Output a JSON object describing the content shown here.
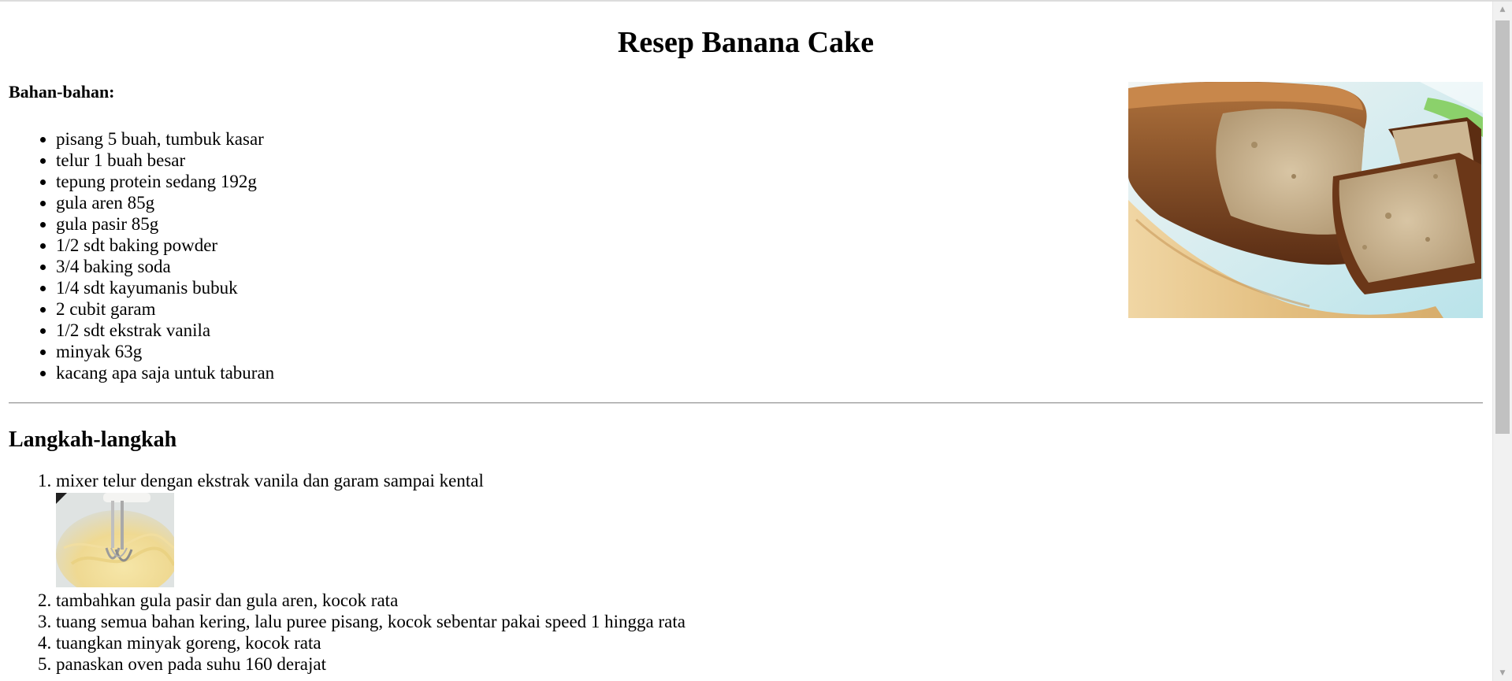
{
  "page": {
    "title": "Resep Banana Cake"
  },
  "ingredients": {
    "heading": "Bahan-bahan:",
    "items": [
      "pisang 5 buah, tumbuk kasar",
      "telur 1 buah besar",
      "tepung protein sedang 192g",
      "gula aren 85g",
      "gula pasir 85g",
      "1/2 sdt baking powder",
      "3/4 baking soda",
      "1/4 sdt kayumanis bubuk",
      "2 cubit garam",
      "1/2 sdt ekstrak vanila",
      "minyak 63g",
      "kacang apa saja untuk taburan"
    ]
  },
  "steps": {
    "heading": "Langkah-langkah",
    "items": [
      "mixer telur dengan ekstrak vanila dan garam sampai kental",
      "tambahkan gula pasir dan gula aren, kocok rata",
      "tuang semua bahan kering, lalu puree pisang, kocok sebentar pakai speed 1 hingga rata",
      "tuangkan minyak goreng, kocok rata",
      "panaskan oven pada suhu 160 derajat"
    ]
  },
  "icons": {
    "scroll_up": "scroll-up-arrow-icon",
    "scroll_down": "scroll-down-arrow-icon"
  }
}
